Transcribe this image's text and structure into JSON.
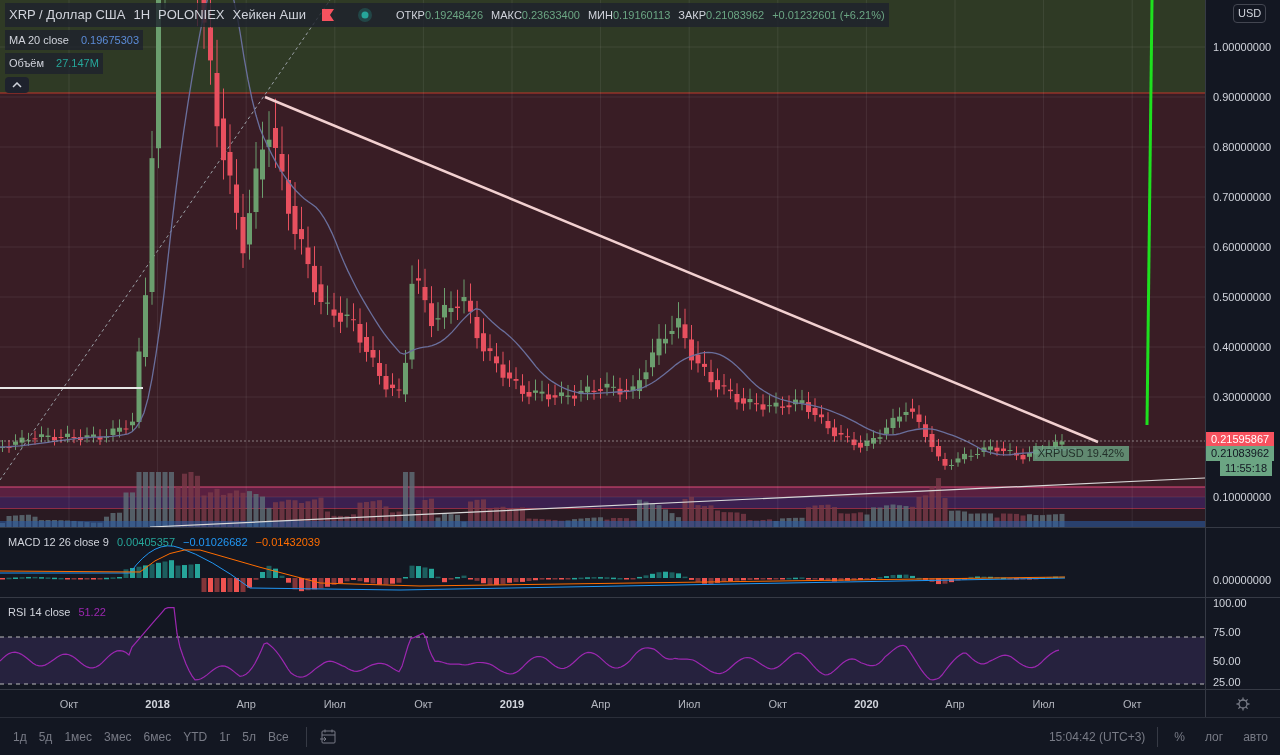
{
  "legend": {
    "symbol": "XRP / Доллар США",
    "interval": "1H",
    "exchange": "POLONIEX",
    "chart_type": "Хейкен Аши",
    "ohlc": [
      {
        "label": "ОТКР",
        "value": "0.19248426"
      },
      {
        "label": "МАКС",
        "value": "0.23633400"
      },
      {
        "label": "МИН",
        "value": "0.19160113"
      },
      {
        "label": "ЗАКР",
        "value": "0.21083962"
      }
    ],
    "change": "+0.01232601 (+6.21%)"
  },
  "indicators": [
    {
      "label": "MA 20 close",
      "value": "0.19675303",
      "color": "#5b8bd6"
    },
    {
      "label": "Объём",
      "value": "27.147M",
      "color": "#26a69a"
    }
  ],
  "price_axis": {
    "currency": "USD",
    "ticks": [
      "1.00000000",
      "0.90000000",
      "0.80000000",
      "0.70000000",
      "0.60000000",
      "0.50000000",
      "0.40000000",
      "0.30000000",
      "0.10000000"
    ],
    "tags": [
      {
        "kind": "last",
        "text": "0.21595867"
      },
      {
        "kind": "current",
        "text": "0.21083962"
      },
      {
        "kind": "countdown",
        "text": "11:55:18"
      }
    ],
    "symbol_tag": "XRPUSD 19.42%"
  },
  "macd": {
    "label": "MACD 12 26 close 9",
    "values": [
      {
        "text": "0.00405357",
        "color": "#26a69a"
      },
      {
        "text": "−0.01026682",
        "color": "#2196f3"
      },
      {
        "text": "−0.01432039",
        "color": "#ff6d00"
      }
    ],
    "axis": "0.00000000"
  },
  "rsi": {
    "label": "RSI 14 close",
    "value": "51.22",
    "ticks": [
      "100.00",
      "75.00",
      "50.00",
      "25.00"
    ]
  },
  "time_axis": [
    {
      "text": "Окт",
      "kind": "month"
    },
    {
      "text": "2018",
      "kind": "year"
    },
    {
      "text": "Апр",
      "kind": "month"
    },
    {
      "text": "Июл",
      "kind": "month"
    },
    {
      "text": "Окт",
      "kind": "month"
    },
    {
      "text": "2019",
      "kind": "year"
    },
    {
      "text": "Апр",
      "kind": "month"
    },
    {
      "text": "Июл",
      "kind": "month"
    },
    {
      "text": "Окт",
      "kind": "month"
    },
    {
      "text": "2020",
      "kind": "year"
    },
    {
      "text": "Апр",
      "kind": "month"
    },
    {
      "text": "Июл",
      "kind": "month"
    },
    {
      "text": "Окт",
      "kind": "month"
    }
  ],
  "ranges": [
    "1д",
    "5д",
    "1мес",
    "3мес",
    "6мес",
    "YTD",
    "1г",
    "5л",
    "Все"
  ],
  "clock": "15:04:42 (UTC+3)",
  "scale_buttons": [
    "%",
    "лог",
    "авто"
  ]
}
